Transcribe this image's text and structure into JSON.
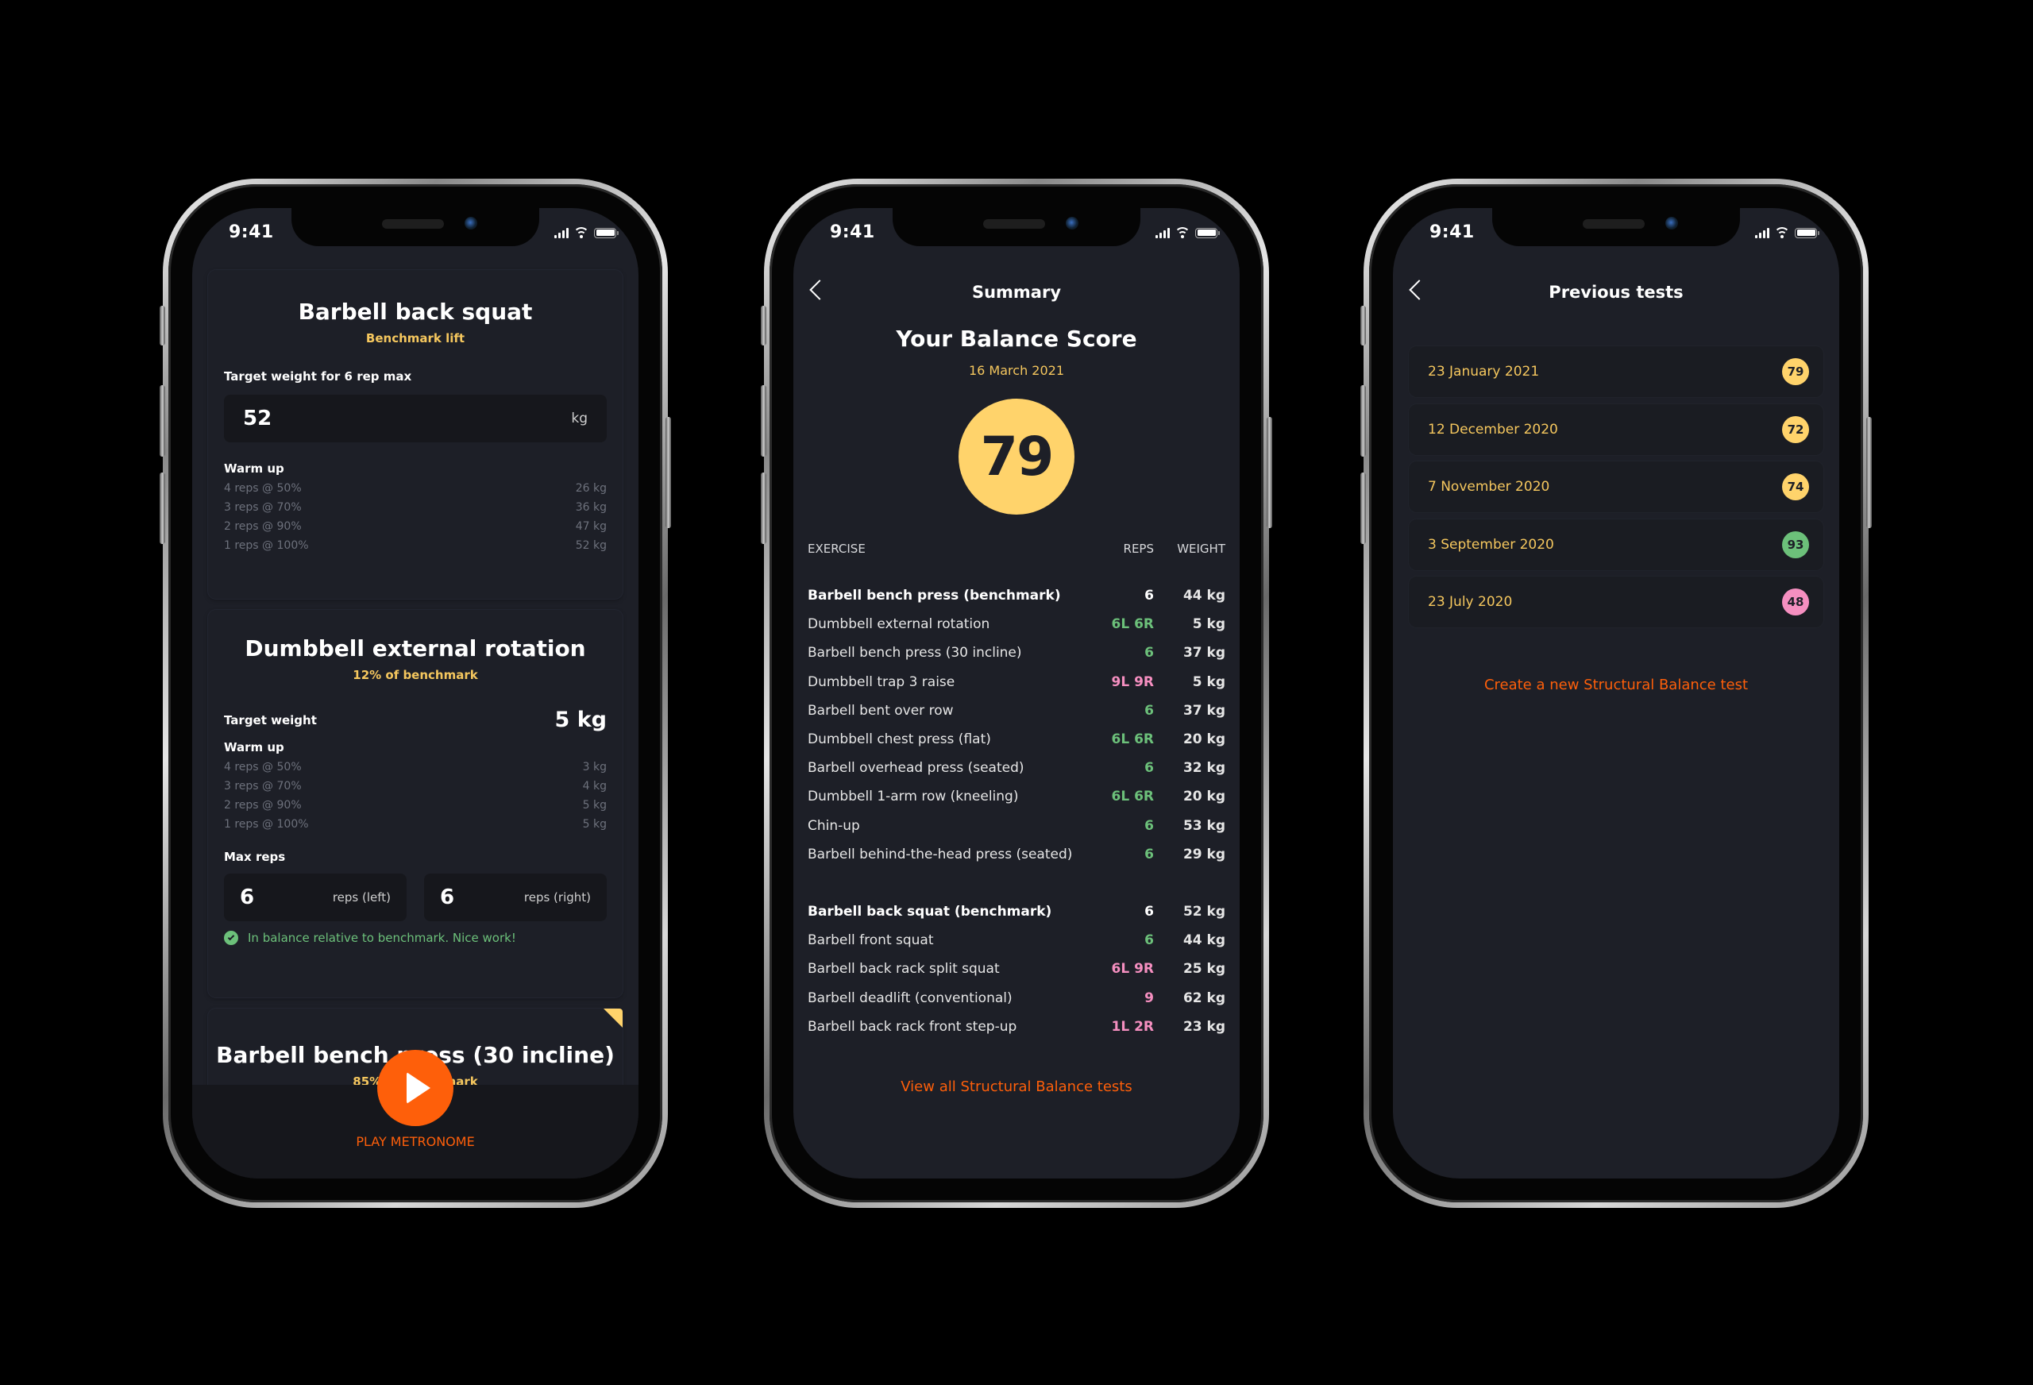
{
  "status_bar": {
    "time": "9:41"
  },
  "colors": {
    "accent_orange": "#fe5f0a",
    "gold": "#f5c75e",
    "score_yellow": "#ffd36b",
    "good_green": "#6cc07a",
    "warn_pink": "#f58fc0",
    "background": "#1d1f27"
  },
  "workout": {
    "cards": [
      {
        "title": "Barbell back squat",
        "subtitle": "Benchmark lift",
        "target_label": "Target weight for 6 rep max",
        "target_value": "52",
        "target_unit": "kg",
        "warmup_label": "Warm up",
        "warmup": [
          {
            "reps": "4 reps @ 50%",
            "weight": "26 kg"
          },
          {
            "reps": "3 reps @ 70%",
            "weight": "36 kg"
          },
          {
            "reps": "2 reps @ 90%",
            "weight": "47 kg"
          },
          {
            "reps": "1 reps @ 100%",
            "weight": "52 kg"
          }
        ]
      },
      {
        "title": "Dumbbell external rotation",
        "subtitle": "12% of benchmark",
        "target_label": "Target weight",
        "target_value": "5 kg",
        "warmup_label": "Warm up",
        "warmup": [
          {
            "reps": "4 reps @ 50%",
            "weight": "3 kg"
          },
          {
            "reps": "3 reps @ 70%",
            "weight": "4 kg"
          },
          {
            "reps": "2 reps @ 90%",
            "weight": "5 kg"
          },
          {
            "reps": "1 reps @ 100%",
            "weight": "5 kg"
          }
        ],
        "max_reps_label": "Max reps",
        "reps_left_value": "6",
        "reps_left_unit": "reps (left)",
        "reps_right_value": "6",
        "reps_right_unit": "reps (right)",
        "balance_message": "In balance relative to benchmark. Nice work!"
      },
      {
        "title": "Barbell bench press (30 incline)",
        "subtitle": "85% of benchmark"
      }
    ],
    "play_label": "PLAY METRONOME"
  },
  "summary": {
    "nav_title": "Summary",
    "score_title": "Your Balance Score",
    "score_date": "16 March 2021",
    "score": "79",
    "columns": {
      "exercise": "EXERCISE",
      "reps": "REPS",
      "weight": "WEIGHT"
    },
    "groups": [
      {
        "rows": [
          {
            "exercise": "Barbell bench press (benchmark)",
            "reps": "6",
            "weight": "44 kg",
            "benchmark": true,
            "status": "neutral"
          },
          {
            "exercise": "Dumbbell external rotation",
            "reps": "6L 6R",
            "weight": "5 kg",
            "status": "good"
          },
          {
            "exercise": "Barbell bench press (30 incline)",
            "reps": "6",
            "weight": "37 kg",
            "status": "good"
          },
          {
            "exercise": "Dumbbell trap 3 raise",
            "reps": "9L 9R",
            "weight": "5 kg",
            "status": "warn"
          },
          {
            "exercise": "Barbell bent  over row",
            "reps": "6",
            "weight": "37 kg",
            "status": "good"
          },
          {
            "exercise": "Dumbbell chest press (flat)",
            "reps": "6L 6R",
            "weight": "20 kg",
            "status": "good"
          },
          {
            "exercise": "Barbell overhead press (seated)",
            "reps": "6",
            "weight": "32 kg",
            "status": "good"
          },
          {
            "exercise": "Dumbbell 1-arm row (kneeling)",
            "reps": "6L 6R",
            "weight": "20 kg",
            "status": "good"
          },
          {
            "exercise": "Chin-up",
            "reps": "6",
            "weight": "53 kg",
            "status": "good"
          },
          {
            "exercise": "Barbell behind-the-head press (seated)",
            "reps": "6",
            "weight": "29 kg",
            "status": "good"
          }
        ]
      },
      {
        "rows": [
          {
            "exercise": "Barbell back squat (benchmark)",
            "reps": "6",
            "weight": "52 kg",
            "benchmark": true,
            "status": "neutral"
          },
          {
            "exercise": "Barbell front squat",
            "reps": "6",
            "weight": "44 kg",
            "status": "good"
          },
          {
            "exercise": "Barbell back rack split squat",
            "reps": "6L 9R",
            "weight": "25 kg",
            "status": "warn"
          },
          {
            "exercise": "Barbell deadlift (conventional)",
            "reps": "9",
            "weight": "62 kg",
            "status": "warn"
          },
          {
            "exercise": "Barbell back rack front step-up",
            "reps": "1L 2R",
            "weight": "23 kg",
            "status": "warn"
          }
        ]
      }
    ],
    "view_all_link": "View all Structural Balance tests"
  },
  "previous": {
    "nav_title": "Previous tests",
    "tests": [
      {
        "date": "23 January 2021",
        "score": "79",
        "status": "mid"
      },
      {
        "date": "12 December 2020",
        "score": "72",
        "status": "mid"
      },
      {
        "date": "7 November 2020",
        "score": "74",
        "status": "mid"
      },
      {
        "date": "3 September 2020",
        "score": "93",
        "status": "good"
      },
      {
        "date": "23 July 2020",
        "score": "48",
        "status": "bad"
      }
    ],
    "create_link": "Create a new Structural Balance test"
  }
}
